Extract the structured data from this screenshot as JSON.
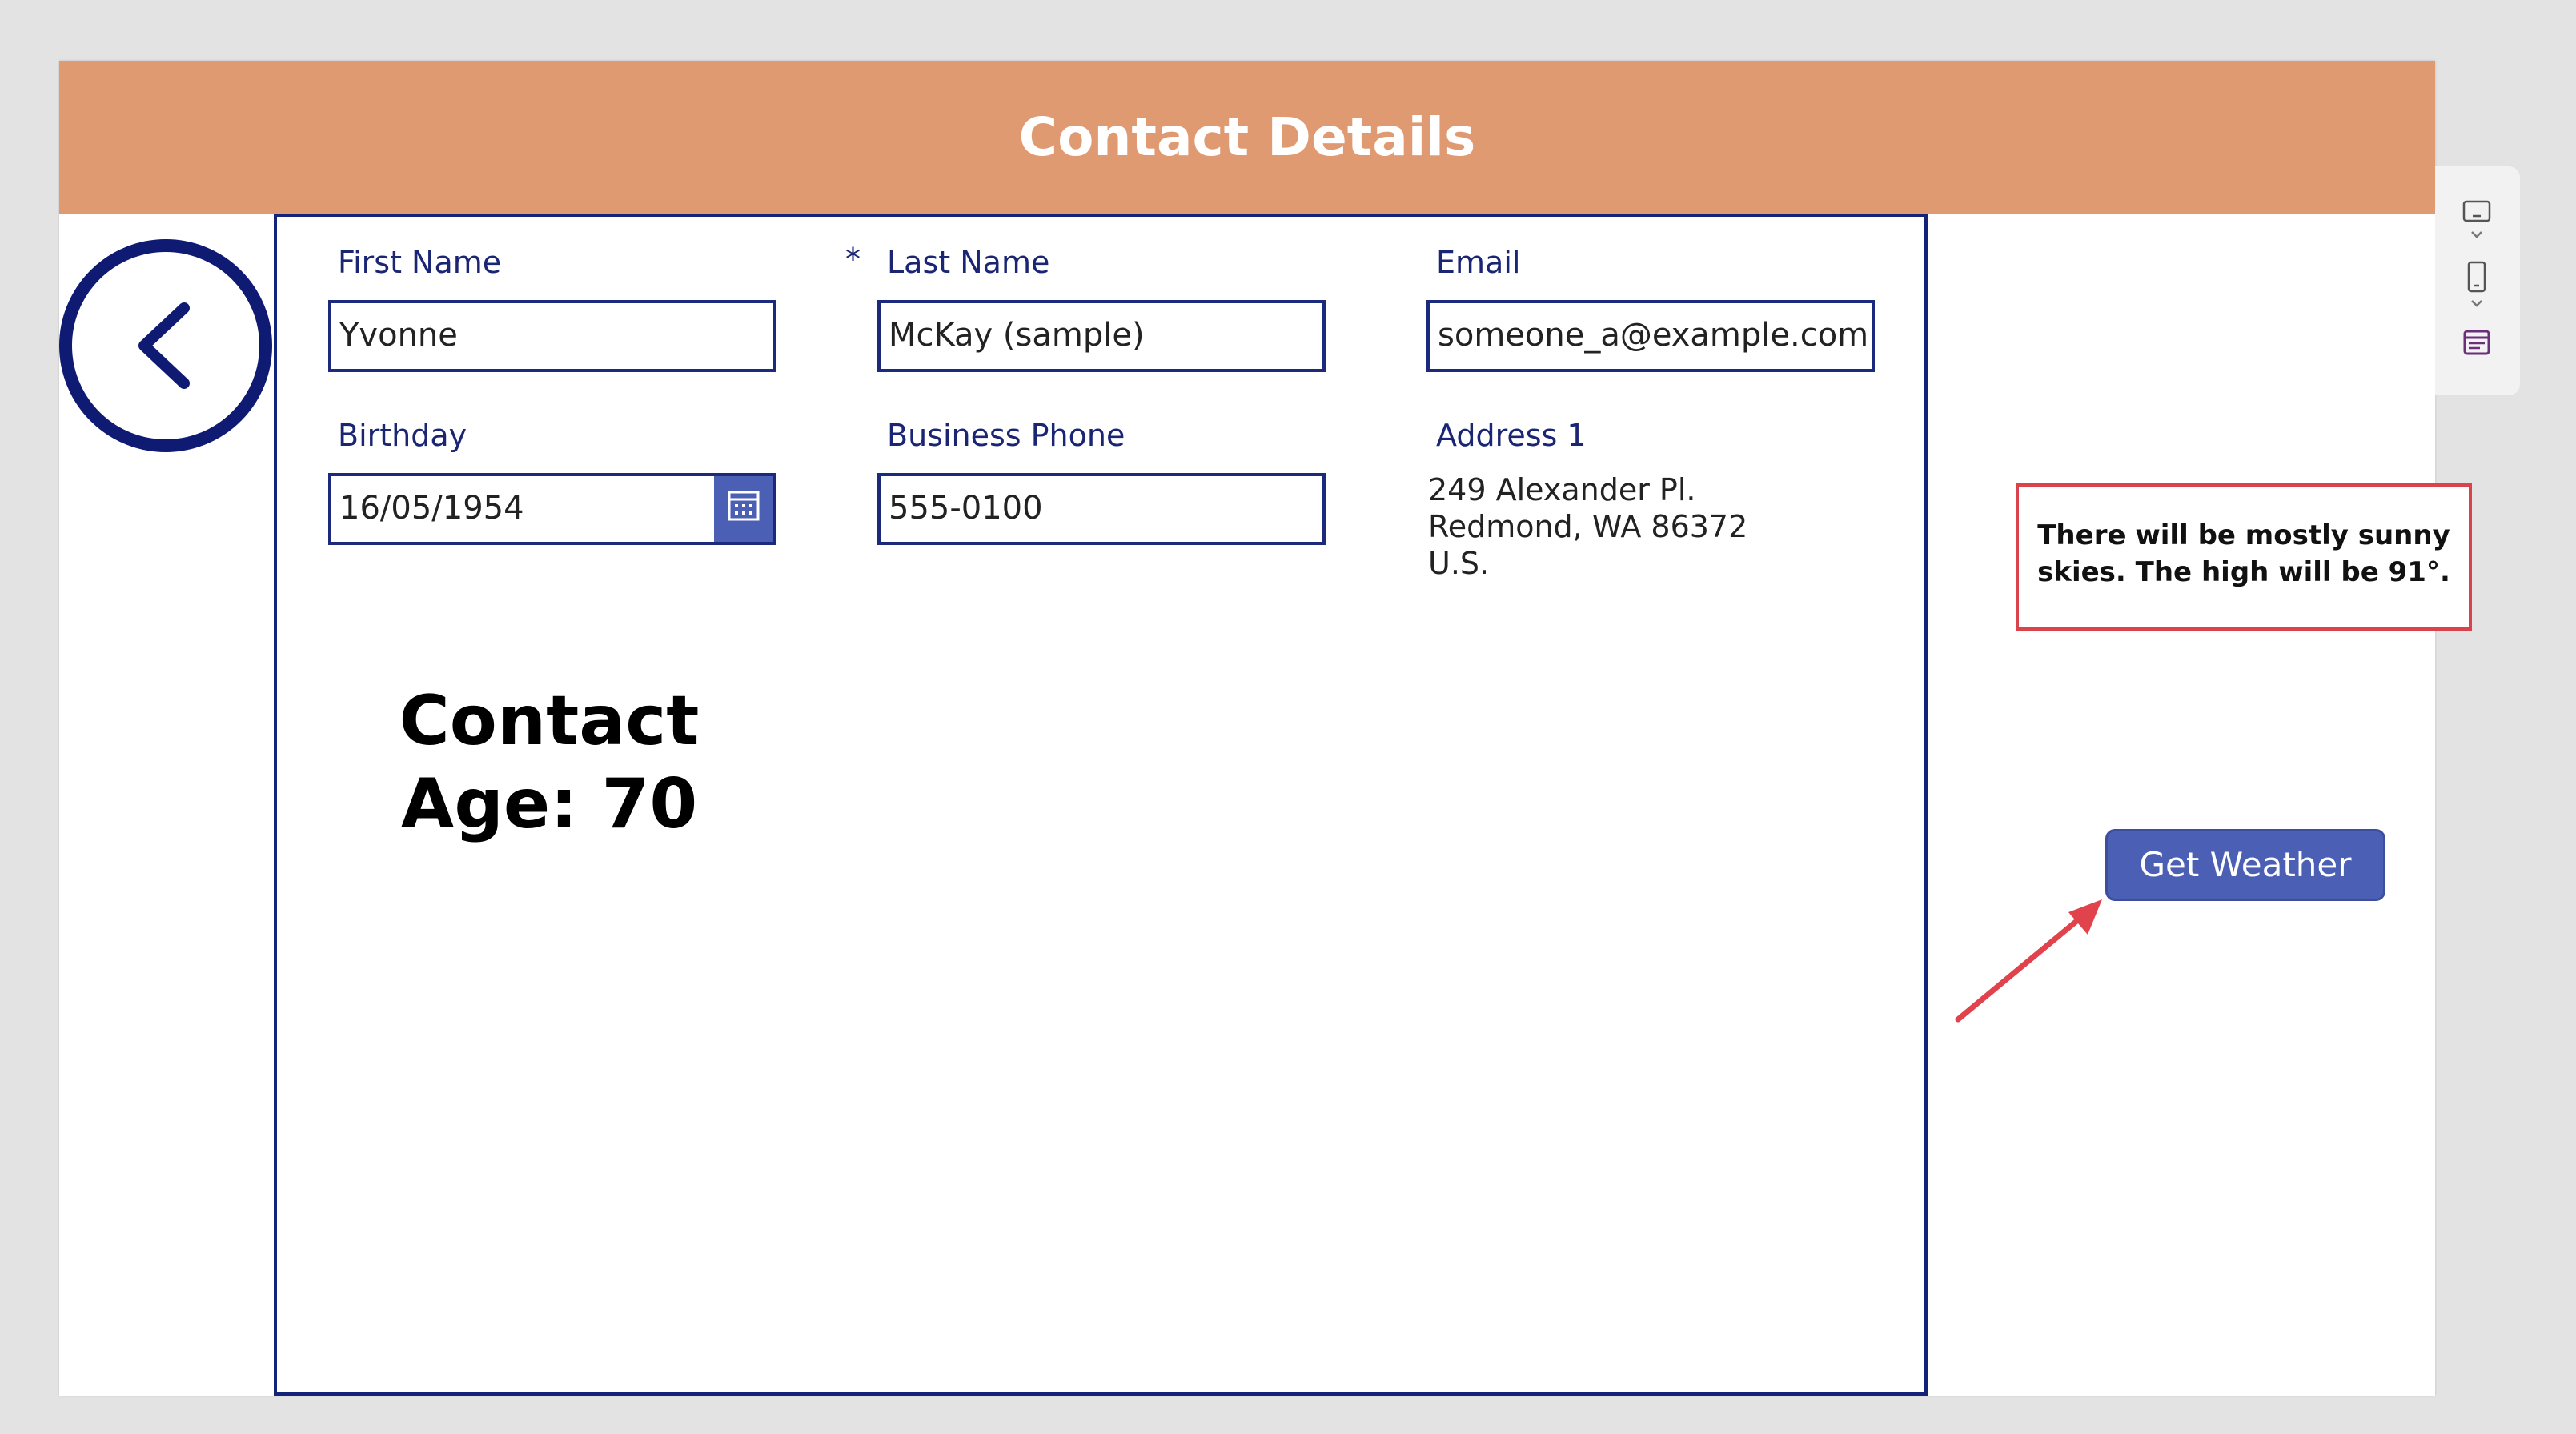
{
  "header": {
    "title": "Contact Details"
  },
  "form": {
    "first_name": {
      "label": "First Name",
      "value": "Yvonne"
    },
    "last_name": {
      "label": "Last Name",
      "required_mark": "*",
      "value": "McKay (sample)"
    },
    "email": {
      "label": "Email",
      "value": "someone_a@example.com"
    },
    "birthday": {
      "label": "Birthday",
      "value": "16/05/1954"
    },
    "business_phone": {
      "label": "Business Phone",
      "value": "555-0100"
    },
    "address": {
      "label": "Address 1",
      "line1": "249 Alexander Pl.",
      "line2": "Redmond, WA 86372",
      "line3": "U.S."
    }
  },
  "age": {
    "line1": "Contact",
    "line2": "Age: 70"
  },
  "weather": {
    "line1": "There will be mostly sunny",
    "line2": "skies.  The high will be 91°.",
    "button_label": "Get Weather"
  },
  "colors": {
    "header": "#e09a72",
    "navy": "#14237a",
    "button": "#4b5fb5",
    "highlight": "#d9434b"
  },
  "icons": {
    "back": "chevron-left-icon",
    "calendar": "calendar-icon",
    "side_panel": [
      "screen-size-icon",
      "phone-icon",
      "form-icon"
    ]
  }
}
